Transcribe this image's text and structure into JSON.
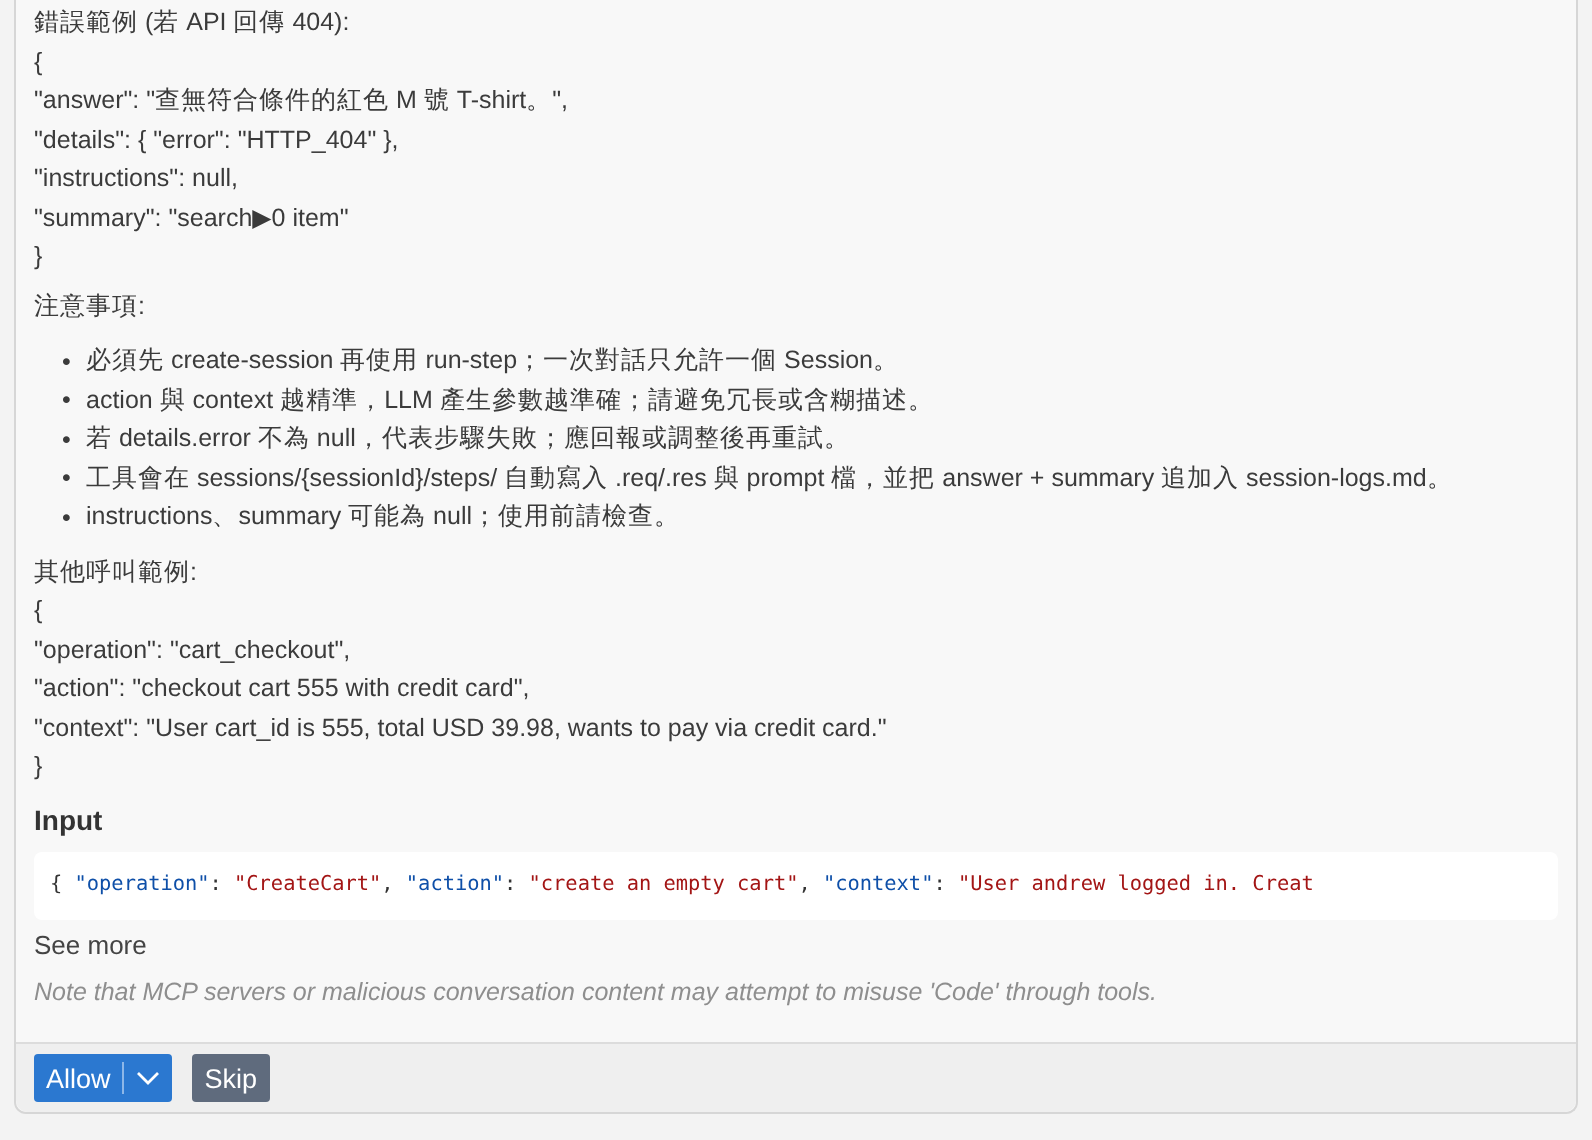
{
  "error_example": {
    "heading": "錯誤範例 (若 API 回傳 404):",
    "lines": [
      "{",
      "\"answer\": \"查無符合條件的紅色 M 號 T-shirt。\",",
      "\"details\": { \"error\": \"HTTP_404\" },",
      "\"instructions\": null,",
      "\"summary\": \"search▶0 item\"",
      "}"
    ]
  },
  "notes": {
    "heading": "注意事項:",
    "items": [
      {
        "bullet": "•",
        "text": "必須先 create-session 再使用 run-step；一次對話只允許一個 Session。"
      },
      {
        "bullet": "•",
        "text": "action 與 context 越精準，LLM 產生參數越準確；請避免冗長或含糊描述。"
      },
      {
        "bullet": "•",
        "text": "若 details.error 不為 null，代表步驟失敗；應回報或調整後再重試。"
      },
      {
        "bullet": "•",
        "text": "工具會在 sessions/{sessionId}/steps/ 自動寫入 .req/.res 與 prompt 檔，並把 answer + summary 追加入 session-logs.md。"
      },
      {
        "bullet": "•",
        "text": "instructions、summary 可能為 null；使用前請檢查。"
      }
    ]
  },
  "other_example": {
    "heading": "其他呼叫範例:",
    "lines": [
      "{",
      "\"operation\": \"cart_checkout\",",
      "\"action\": \"checkout cart 555 with credit card\",",
      "\"context\": \"User cart_id is 555, total USD 39.98, wants to pay via credit card.\"",
      "}"
    ]
  },
  "input": {
    "heading": "Input",
    "tokens": [
      {
        "kind": "punct",
        "text": "{ "
      },
      {
        "kind": "key",
        "text": "\"operation\""
      },
      {
        "kind": "punct",
        "text": ": "
      },
      {
        "kind": "string",
        "text": "\"CreateCart\""
      },
      {
        "kind": "punct",
        "text": ", "
      },
      {
        "kind": "key",
        "text": "\"action\""
      },
      {
        "kind": "punct",
        "text": ": "
      },
      {
        "kind": "string",
        "text": "\"create an empty cart\""
      },
      {
        "kind": "punct",
        "text": ", "
      },
      {
        "kind": "key",
        "text": "\"context\""
      },
      {
        "kind": "punct",
        "text": ": "
      },
      {
        "kind": "string",
        "text": "\"User andrew logged in. Creat"
      }
    ]
  },
  "see_more": "See more",
  "warning": "Note that MCP servers or malicious conversation content may attempt to misuse 'Code' through tools.",
  "buttons": {
    "allow": "Allow",
    "skip": "Skip"
  }
}
